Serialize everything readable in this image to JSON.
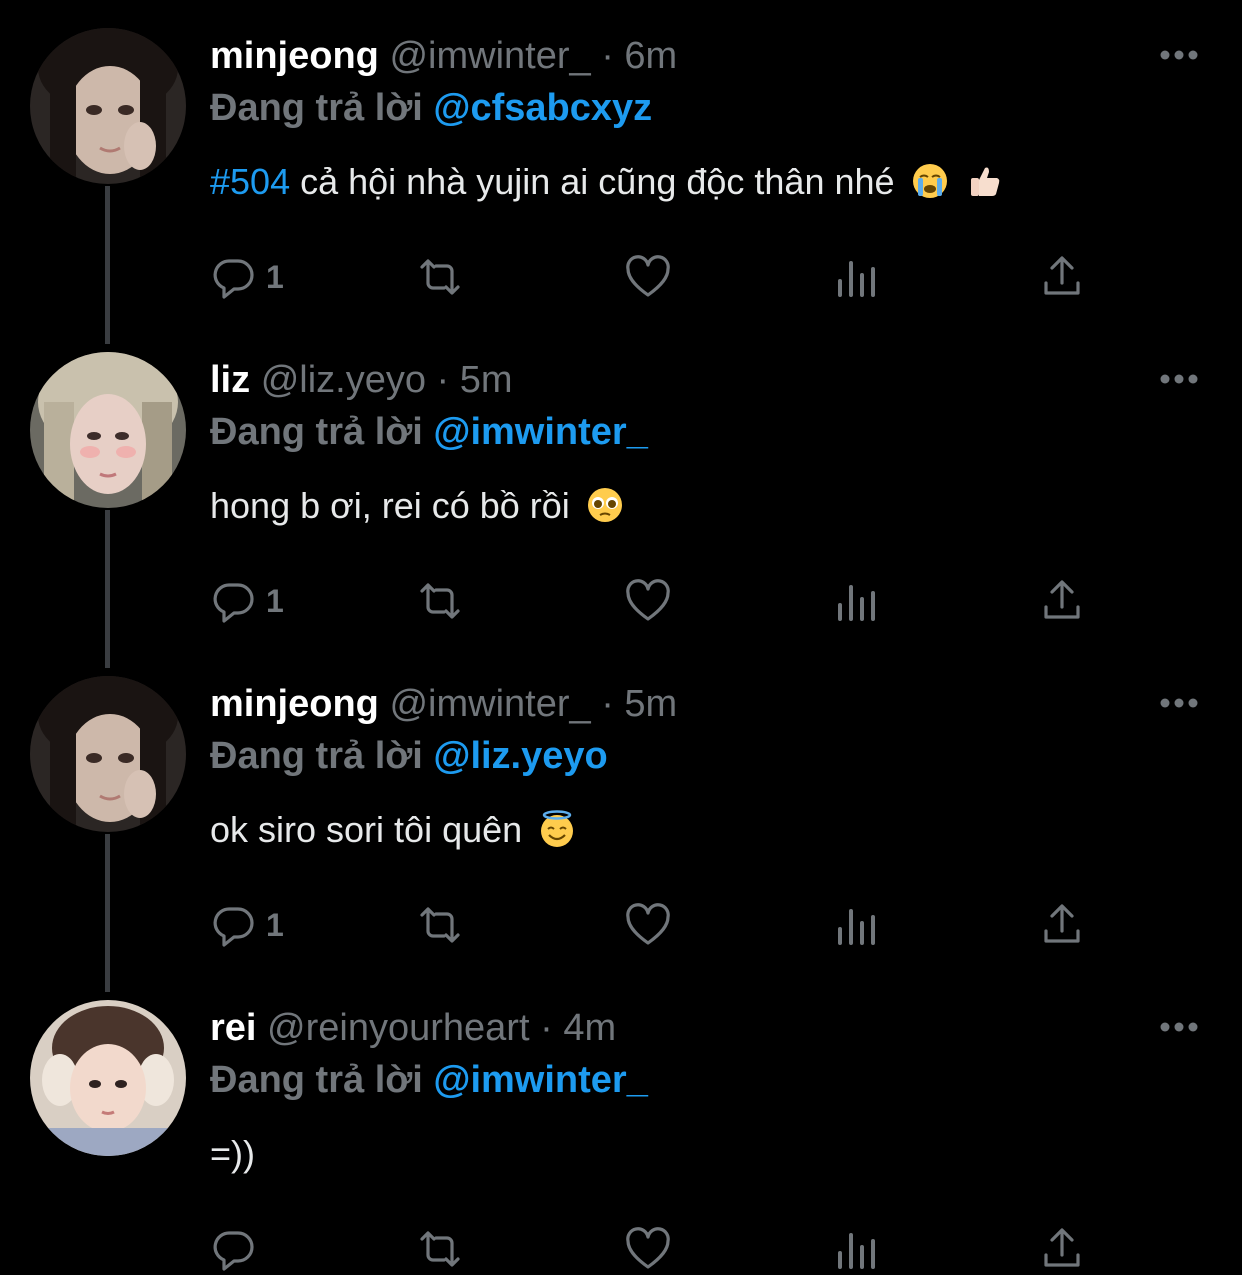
{
  "colors": {
    "background": "#000000",
    "accent": "#1d9bf0",
    "muted": "#71767b",
    "text": "#e7e9ea"
  },
  "tweets": [
    {
      "name": "minjeong",
      "handle": "@imwinter_",
      "dot": "·",
      "time": "6m",
      "reply_prefix": "Đang trả lời",
      "reply_to": "@cfsabcxyz",
      "hashtag": "#504",
      "text": " cả hội nhà yujin ai cũng độc thân nhé",
      "emojis": [
        "loudly-crying-face",
        "thumbs-up"
      ],
      "reply_count": "1",
      "avatar": "minjeong-avatar"
    },
    {
      "name": "liz",
      "handle": "@liz.yeyo",
      "dot": "·",
      "time": "5m",
      "reply_prefix": "Đang trả lời",
      "reply_to": "@imwinter_",
      "hashtag": "",
      "text": "hong b ơi, rei có bồ rồi",
      "emojis": [
        "pleading-face"
      ],
      "reply_count": "1",
      "avatar": "liz-avatar"
    },
    {
      "name": "minjeong",
      "handle": "@imwinter_",
      "dot": "·",
      "time": "5m",
      "reply_prefix": "Đang trả lời",
      "reply_to": "@liz.yeyo",
      "hashtag": "",
      "text": "ok siro sori tôi quên",
      "emojis": [
        "smiling-face-with-halo"
      ],
      "reply_count": "1",
      "avatar": "minjeong-avatar"
    },
    {
      "name": "rei",
      "handle": "@reinyourheart",
      "dot": "·",
      "time": "4m",
      "reply_prefix": "Đang trả lời",
      "reply_to": "@imwinter_",
      "hashtag": "",
      "text": "=))",
      "emojis": [],
      "reply_count": "",
      "avatar": "rei-avatar"
    }
  ],
  "icons": {
    "reply": "reply-icon",
    "retweet": "retweet-icon",
    "like": "like-icon",
    "views": "views-icon",
    "share": "share-icon",
    "more": "more-icon"
  }
}
